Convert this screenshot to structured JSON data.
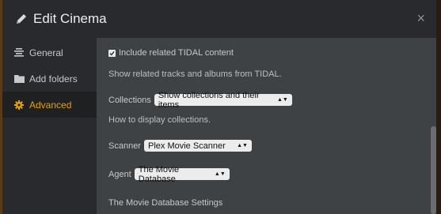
{
  "modal": {
    "title": "Edit Cinema",
    "close_glyph": "×"
  },
  "sidebar": {
    "items": [
      {
        "label": "General",
        "icon": "list-icon"
      },
      {
        "label": "Add folders",
        "icon": "folder-icon"
      },
      {
        "label": "Advanced",
        "icon": "gear-icon",
        "active": true
      }
    ]
  },
  "settings": {
    "tidal_checkbox_label": "Include related TIDAL content",
    "tidal_checked": true,
    "tidal_help": "Show related tracks and albums from TIDAL.",
    "collections_label": "Collections",
    "collections_value": "Show collections and their items",
    "collections_help": "How to display collections.",
    "scanner_label": "Scanner",
    "scanner_value": "Plex Movie Scanner",
    "agent_label": "Agent",
    "agent_value": "The Movie Database",
    "agent_settings_heading": "The Movie Database Settings"
  },
  "colors": {
    "accent": "#e5a00d",
    "header_bg": "#282a2d",
    "content_bg": "#3f4245"
  }
}
